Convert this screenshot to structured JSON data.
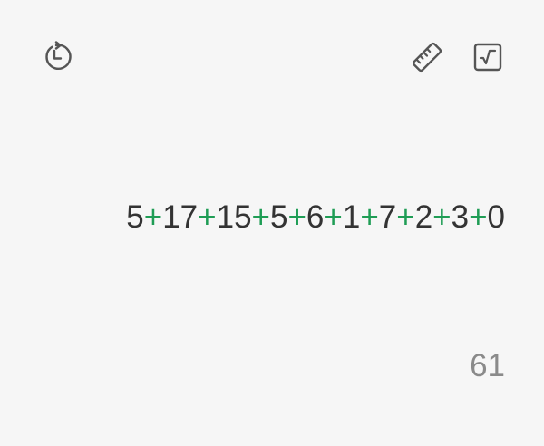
{
  "toolbar": {
    "history_icon": "history-clock-icon",
    "ruler_icon": "ruler-icon",
    "scientific_icon": "square-root-icon"
  },
  "display": {
    "tokens": [
      {
        "type": "num",
        "text": "5"
      },
      {
        "type": "op",
        "text": "+"
      },
      {
        "type": "num",
        "text": "17"
      },
      {
        "type": "op",
        "text": "+"
      },
      {
        "type": "num",
        "text": "15"
      },
      {
        "type": "op",
        "text": "+"
      },
      {
        "type": "num",
        "text": "5"
      },
      {
        "type": "op",
        "text": "+"
      },
      {
        "type": "num",
        "text": "6"
      },
      {
        "type": "op",
        "text": "+"
      },
      {
        "type": "num",
        "text": "1"
      },
      {
        "type": "op",
        "text": "+"
      },
      {
        "type": "num",
        "text": "7"
      },
      {
        "type": "op",
        "text": "+"
      },
      {
        "type": "num",
        "text": "2"
      },
      {
        "type": "op",
        "text": "+"
      },
      {
        "type": "num",
        "text": "3"
      },
      {
        "type": "op",
        "text": "+"
      },
      {
        "type": "num",
        "text": "0"
      }
    ],
    "result": "61"
  },
  "colors": {
    "background": "#f6f6f6",
    "text": "#333333",
    "operator": "#1f9d55",
    "result": "#8a8a8a",
    "icon": "#555555"
  }
}
